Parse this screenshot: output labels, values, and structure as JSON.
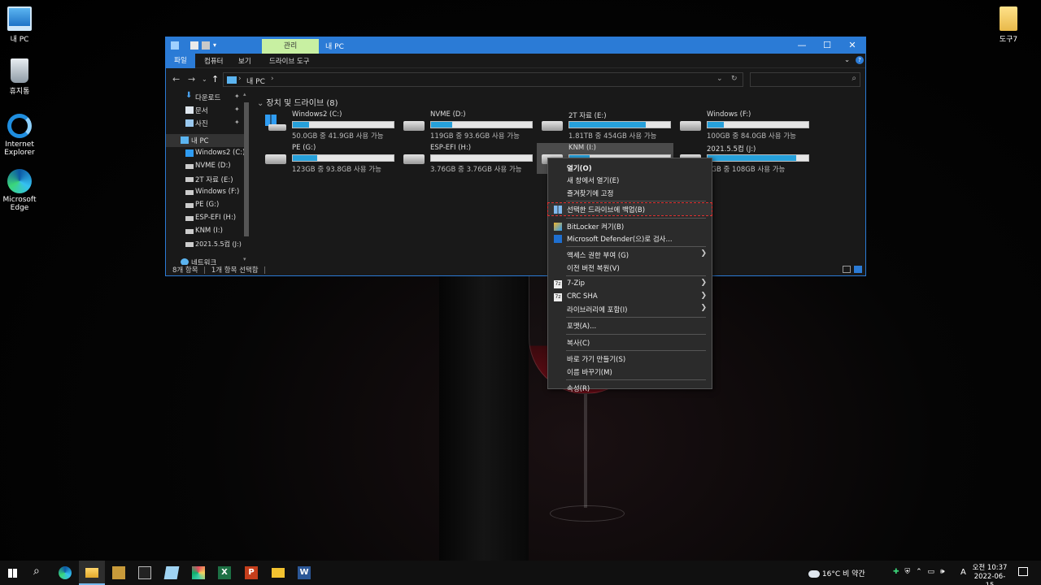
{
  "colors": {
    "accent": "#2b7bd6",
    "manage_tab": "#c8f0a2",
    "drive_fill": "#26a0da",
    "highlight_box": "#e03030"
  },
  "desktop_icons": [
    {
      "label": "내 PC",
      "icon": "computer-icon"
    },
    {
      "label": "휴지통",
      "icon": "recycle-bin-icon"
    },
    {
      "label": "Internet Explorer",
      "icon": "internet-explorer-icon"
    },
    {
      "label": "Microsoft Edge",
      "icon": "edge-icon"
    },
    {
      "label": "도구7",
      "icon": "folder-icon"
    }
  ],
  "window": {
    "manage_tab": "관리",
    "title": "내 PC",
    "controls": {
      "minimize": "—",
      "maximize": "☐",
      "close": "✕"
    },
    "ribbon_tabs": [
      "파일",
      "컴퓨터",
      "보기",
      "드라이브 도구"
    ],
    "address": "내 PC",
    "search_placeholder": ""
  },
  "sidebar": {
    "items": [
      {
        "label": "다운로드",
        "icon": "download-icon",
        "pinned": true
      },
      {
        "label": "문서",
        "icon": "documents-icon",
        "pinned": true
      },
      {
        "label": "사진",
        "icon": "pictures-icon",
        "pinned": true
      },
      {
        "label": "내 PC",
        "icon": "computer-icon",
        "pinned": false
      },
      {
        "label": "Windows2 (C:)",
        "icon": "drive-icon",
        "pinned": false
      },
      {
        "label": "NVME (D:)",
        "icon": "drive-icon",
        "pinned": false
      },
      {
        "label": "2T 자료 (E:)",
        "icon": "drive-icon",
        "pinned": false
      },
      {
        "label": "Windows (F:)",
        "icon": "drive-icon",
        "pinned": false
      },
      {
        "label": "PE (G:)",
        "icon": "drive-icon",
        "pinned": false
      },
      {
        "label": "ESP-EFI (H:)",
        "icon": "drive-icon",
        "pinned": false
      },
      {
        "label": "KNM (I:)",
        "icon": "drive-icon",
        "pinned": false
      },
      {
        "label": "2021.5.5컴 (J:)",
        "icon": "drive-icon",
        "pinned": false
      },
      {
        "label": "네트워크",
        "icon": "network-icon",
        "pinned": false
      }
    ],
    "pin_glyph": "📌"
  },
  "content": {
    "group_title": "장치 및 드라이브 (8)",
    "drives": [
      {
        "name": "Windows2 (C:)",
        "info": "50.0GB 중 41.9GB 사용 가능",
        "used": 0.16,
        "system": true
      },
      {
        "name": "NVME (D:)",
        "info": "119GB 중 93.6GB 사용 가능",
        "used": 0.21,
        "system": false
      },
      {
        "name": "2T 자료 (E:)",
        "info": "1.81TB 중 454GB 사용 가능",
        "used": 0.76,
        "system": false
      },
      {
        "name": "Windows (F:)",
        "info": "100GB 중 84.0GB 사용 가능",
        "used": 0.16,
        "system": false
      },
      {
        "name": "PE (G:)",
        "info": "123GB 중 93.8GB 사용 가능",
        "used": 0.24,
        "system": false
      },
      {
        "name": "ESP-EFI (H:)",
        "info": "3.76GB 중 3.76GB 사용 가능",
        "used": 0.0,
        "system": false
      },
      {
        "name": "KNM (I:)",
        "info": "",
        "used": 0.2,
        "system": false
      },
      {
        "name": "2021.5.5컴 (J:)",
        "info": "7GB 중 108GB 사용 가능",
        "used": 0.88,
        "system": false
      }
    ]
  },
  "status": {
    "items_count": "8개 항목",
    "selected": "1개 항목 선택함"
  },
  "context_menu": [
    {
      "label": "열기(O)",
      "bold": true
    },
    {
      "label": "새 창에서 열기(E)"
    },
    {
      "label": "즐겨찾기에 고정"
    },
    {
      "sep": true
    },
    {
      "label": "선택한 드라이브에 백업(B)",
      "icon": "backup-icon",
      "highlight": true
    },
    {
      "sep": true
    },
    {
      "label": "BitLocker 켜기(B)",
      "icon": "bitlocker-shield-icon"
    },
    {
      "label": "Microsoft Defender(으)로 검사...",
      "icon": "defender-icon"
    },
    {
      "sep": true
    },
    {
      "label": "액세스 권한 부여 (G)",
      "submenu": true
    },
    {
      "label": "이전 버전 복원(V)"
    },
    {
      "sep": true
    },
    {
      "label": "7-Zip",
      "icon": "7zip-icon",
      "submenu": true
    },
    {
      "label": "CRC SHA",
      "icon": "7zip-icon",
      "submenu": true
    },
    {
      "label": "라이브러리에 포함(I)",
      "submenu": true
    },
    {
      "sep": true
    },
    {
      "label": "포맷(A)..."
    },
    {
      "sep": true
    },
    {
      "label": "복사(C)"
    },
    {
      "sep": true
    },
    {
      "label": "바로 가기 만들기(S)"
    },
    {
      "label": "이름 바꾸기(M)"
    },
    {
      "sep": true
    },
    {
      "label": "속성(R)"
    }
  ],
  "submenu_arrow": "❯",
  "taskbar": {
    "buttons": [
      "start-icon",
      "search-icon",
      "edge-icon",
      "file-explorer-icon",
      "app-icon",
      "terminal-icon",
      "notepad-icon",
      "paint-icon",
      "excel-icon",
      "powerpoint-icon",
      "hwp-icon",
      "word-icon"
    ],
    "weather": "16°C  비 약간",
    "ime": "A",
    "time": "오전 10:37",
    "date": "2022-06-15"
  }
}
